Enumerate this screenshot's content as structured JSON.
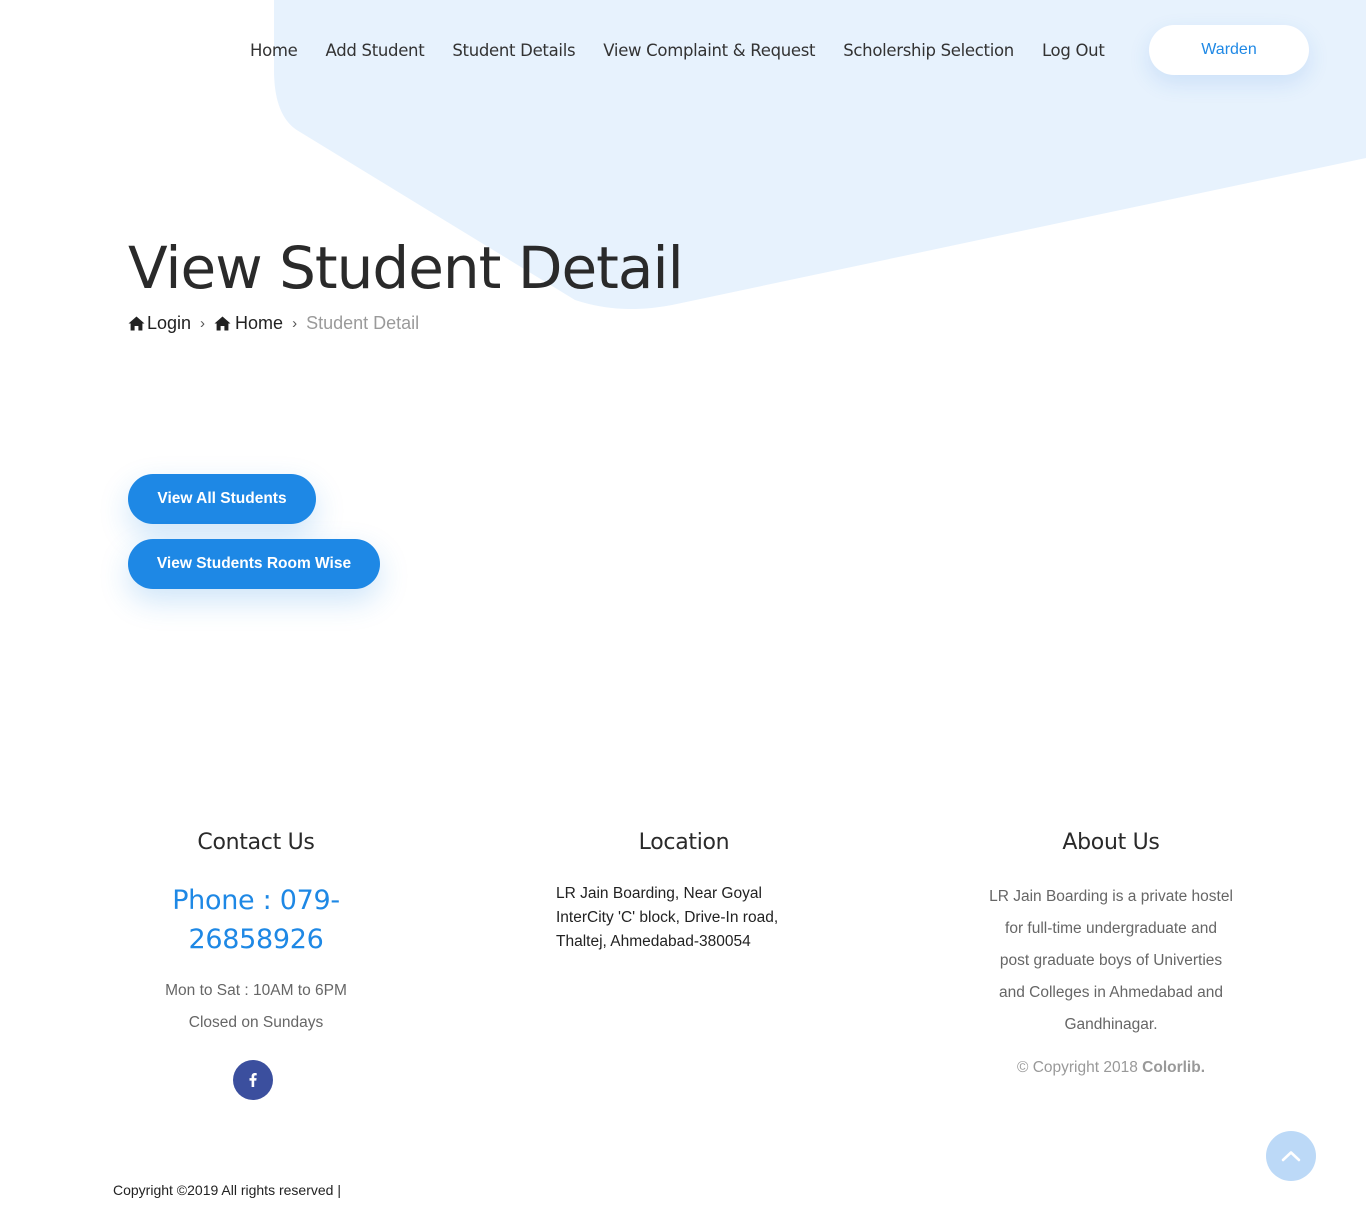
{
  "nav": {
    "items": [
      {
        "label": "Home"
      },
      {
        "label": "Add Student"
      },
      {
        "label": "Student Details"
      },
      {
        "label": "View Complaint & Request"
      },
      {
        "label": "Scholership Selection"
      },
      {
        "label": "Log Out"
      }
    ],
    "user_button": "Warden"
  },
  "hero": {
    "title": "View Student Detail",
    "breadcrumb": {
      "login": "Login",
      "home": "Home",
      "current": "Student Detail"
    }
  },
  "actions": {
    "view_all": "View All Students",
    "view_room_wise": "View Students Room Wise"
  },
  "footer": {
    "contact": {
      "heading": "Contact Us",
      "phone_line1": "Phone : 079-",
      "phone_line2": "26858926",
      "hours": "Mon to Sat : 10AM to 6PM",
      "closed": "Closed on Sundays"
    },
    "location": {
      "heading": "Location",
      "line1": "LR Jain Boarding, Near Goyal",
      "line2": "InterCity 'C' block, Drive-In road,",
      "line3": "Thaltej, Ahmedabad-380054"
    },
    "about": {
      "heading": "About Us",
      "line1": "LR Jain Boarding is a private hostel",
      "line2": "for full-time undergraduate and",
      "line3": "post graduate boys of Univerties",
      "line4": "and Colleges in Ahmedabad and",
      "line5": "Gandhinagar.",
      "copyright_prefix": "© Copyright 2018 ",
      "copyright_brand": "Colorlib."
    },
    "bottom_copyright": "Copyright ©2019 All rights reserved |"
  },
  "colors": {
    "accent": "#1e88e5",
    "bg_shape": "#e7f2fd",
    "facebook": "#3b4f9e",
    "scroll_top": "#bcd9f7"
  },
  "icons": {
    "breadcrumb": "home-icon",
    "social": "facebook-icon",
    "scroll": "chevron-up-icon"
  }
}
